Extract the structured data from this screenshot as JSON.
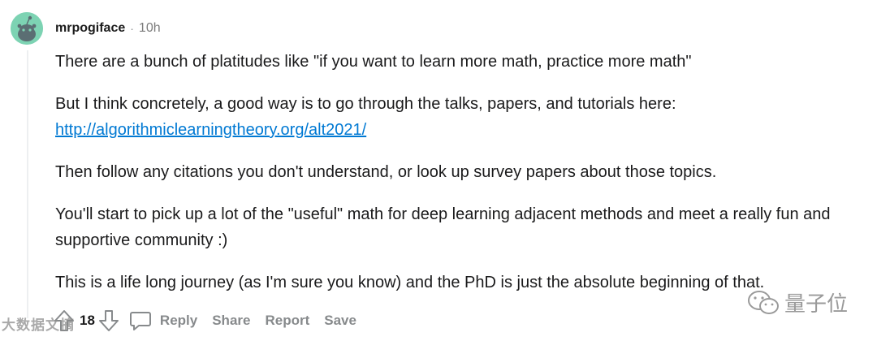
{
  "comment": {
    "username": "mrpogiface",
    "separator": "·",
    "time": "10h",
    "paragraphs": {
      "p1": "There are a bunch of platitudes like \"if you want to learn more math, practice more math\"",
      "p2": "But I think concretely, a good way is to go through the talks, papers, and tutorials here:",
      "p2_link": "http://algorithmiclearningtheory.org/alt2021/",
      "p3": "Then follow any citations you don't understand, or look up survey papers about those topics.",
      "p4": "You'll start to pick up a lot of the \"useful\" math for deep learning adjacent methods and meet a really fun and supportive community :)",
      "p5": "This is a life long journey (as I'm sure you know) and the PhD is just the absolute beginning of that."
    }
  },
  "actions": {
    "vote_count": "18",
    "reply": "Reply",
    "share": "Share",
    "report": "Report",
    "save": "Save"
  },
  "watermarks": {
    "left": "大数据文摘",
    "right": "量子位"
  },
  "icons": {
    "avatar": "snoo-avatar-icon",
    "upvote": "upvote-arrow-icon",
    "downvote": "downvote-arrow-icon",
    "reply": "speech-bubble-icon",
    "wechat": "wechat-icon"
  },
  "colors": {
    "link": "#0079d3",
    "avatar_bg": "#7dd3b3",
    "muted": "#878a8c"
  }
}
